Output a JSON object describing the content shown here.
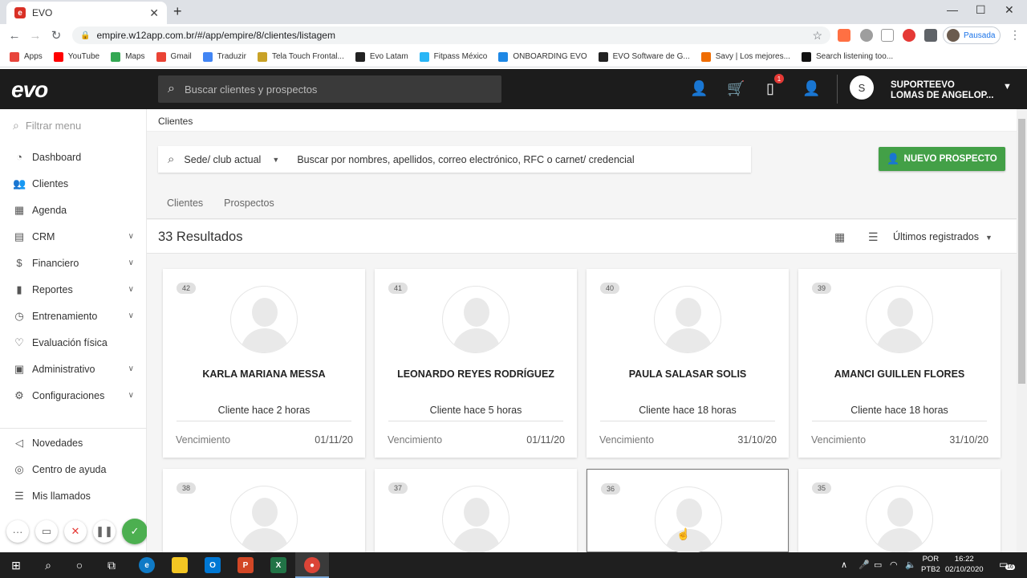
{
  "browser": {
    "tab_title": "EVO",
    "tab_favicon": "e",
    "url": "empire.w12app.com.br/#/app/empire/8/clientes/listagem",
    "profile_label": "Pausada",
    "bookmarks": [
      {
        "label": "Apps",
        "color": "#e8453c"
      },
      {
        "label": "YouTube",
        "color": "#ff0000"
      },
      {
        "label": "Maps",
        "color": "#34a853"
      },
      {
        "label": "Gmail",
        "color": "#ea4335"
      },
      {
        "label": "Traduzir",
        "color": "#4285f4"
      },
      {
        "label": "Tela Touch Frontal...",
        "color": "#c9a227"
      },
      {
        "label": "Evo Latam",
        "color": "#222222"
      },
      {
        "label": "Fitpass México",
        "color": "#29b6f6"
      },
      {
        "label": "ONBOARDING EVO",
        "color": "#1e88e5"
      },
      {
        "label": "EVO Software de G...",
        "color": "#222222"
      },
      {
        "label": "Savy | Los mejores...",
        "color": "#ef6c00"
      },
      {
        "label": "Search listening too...",
        "color": "#111111"
      }
    ]
  },
  "app": {
    "logo": "evo",
    "search_placeholder": "Buscar clientes y prospectos",
    "notification_count": "1",
    "user_initial": "S",
    "user_name": "SUPORTEEVO",
    "user_location": "LOMAS DE ANGELOP..."
  },
  "sidebar": {
    "filter_placeholder": "Filtrar menu",
    "items": [
      {
        "label": "Dashboard",
        "icon": "dashboard-icon",
        "glyph": "◔",
        "expandable": false
      },
      {
        "label": "Clientes",
        "icon": "clients-icon",
        "glyph": "👥",
        "expandable": false
      },
      {
        "label": "Agenda",
        "icon": "calendar-icon",
        "glyph": "▦",
        "expandable": false
      },
      {
        "label": "CRM",
        "icon": "crm-icon",
        "glyph": "▤",
        "expandable": true
      },
      {
        "label": "Financiero",
        "icon": "finance-icon",
        "glyph": "$",
        "expandable": true
      },
      {
        "label": "Reportes",
        "icon": "reports-icon",
        "glyph": "▮",
        "expandable": true
      },
      {
        "label": "Entrenamiento",
        "icon": "timer-icon",
        "glyph": "◷",
        "expandable": true
      },
      {
        "label": "Evaluación física",
        "icon": "heartbeat-icon",
        "glyph": "♡",
        "expandable": false
      },
      {
        "label": "Administrativo",
        "icon": "briefcase-icon",
        "glyph": "▣",
        "expandable": true
      },
      {
        "label": "Configuraciones",
        "icon": "gear-icon",
        "glyph": "⚙",
        "expandable": true
      }
    ],
    "bottom_items": [
      {
        "label": "Novedades",
        "icon": "megaphone-icon",
        "glyph": "◁"
      },
      {
        "label": "Centro de ayuda",
        "icon": "lifebuoy-icon",
        "glyph": "◎"
      },
      {
        "label": "Mis llamados",
        "icon": "list-icon",
        "glyph": "☰"
      }
    ]
  },
  "main": {
    "breadcrumb": "Clientes",
    "sede_label": "Sede/ club actual",
    "search_placeholder": "Buscar por nombres, apellidos, correo electrónico, RFC o carnet/ credencial",
    "new_button": "NUEVO PROSPECTO",
    "tabs": [
      "Clientes",
      "Prospectos"
    ],
    "results": "33 Resultados",
    "sort": "Últimos registrados",
    "expiry_label": "Vencimiento",
    "cards": [
      {
        "num": "42",
        "name": "KARLA MARIANA MESSA",
        "since": "Cliente hace 2 horas",
        "date": "01/11/20"
      },
      {
        "num": "41",
        "name": "LEONARDO REYES RODRÍGUEZ",
        "since": "Cliente hace 5 horas",
        "date": "01/11/20"
      },
      {
        "num": "40",
        "name": "PAULA SALASAR SOLIS",
        "since": "Cliente hace 18 horas",
        "date": "31/10/20"
      },
      {
        "num": "39",
        "name": "AMANCI GUILLEN FLORES",
        "since": "Cliente hace 18 horas",
        "date": "31/10/20"
      },
      {
        "num": "38",
        "name": "",
        "since": "",
        "date": ""
      },
      {
        "num": "37",
        "name": "",
        "since": "",
        "date": ""
      },
      {
        "num": "36",
        "name": "",
        "since": "",
        "date": ""
      },
      {
        "num": "35",
        "name": "",
        "since": "",
        "date": ""
      }
    ]
  },
  "taskbar": {
    "lang": "POR",
    "layout": "PTB2",
    "time": "16:22",
    "date": "02/10/2020",
    "notifications": "16"
  }
}
